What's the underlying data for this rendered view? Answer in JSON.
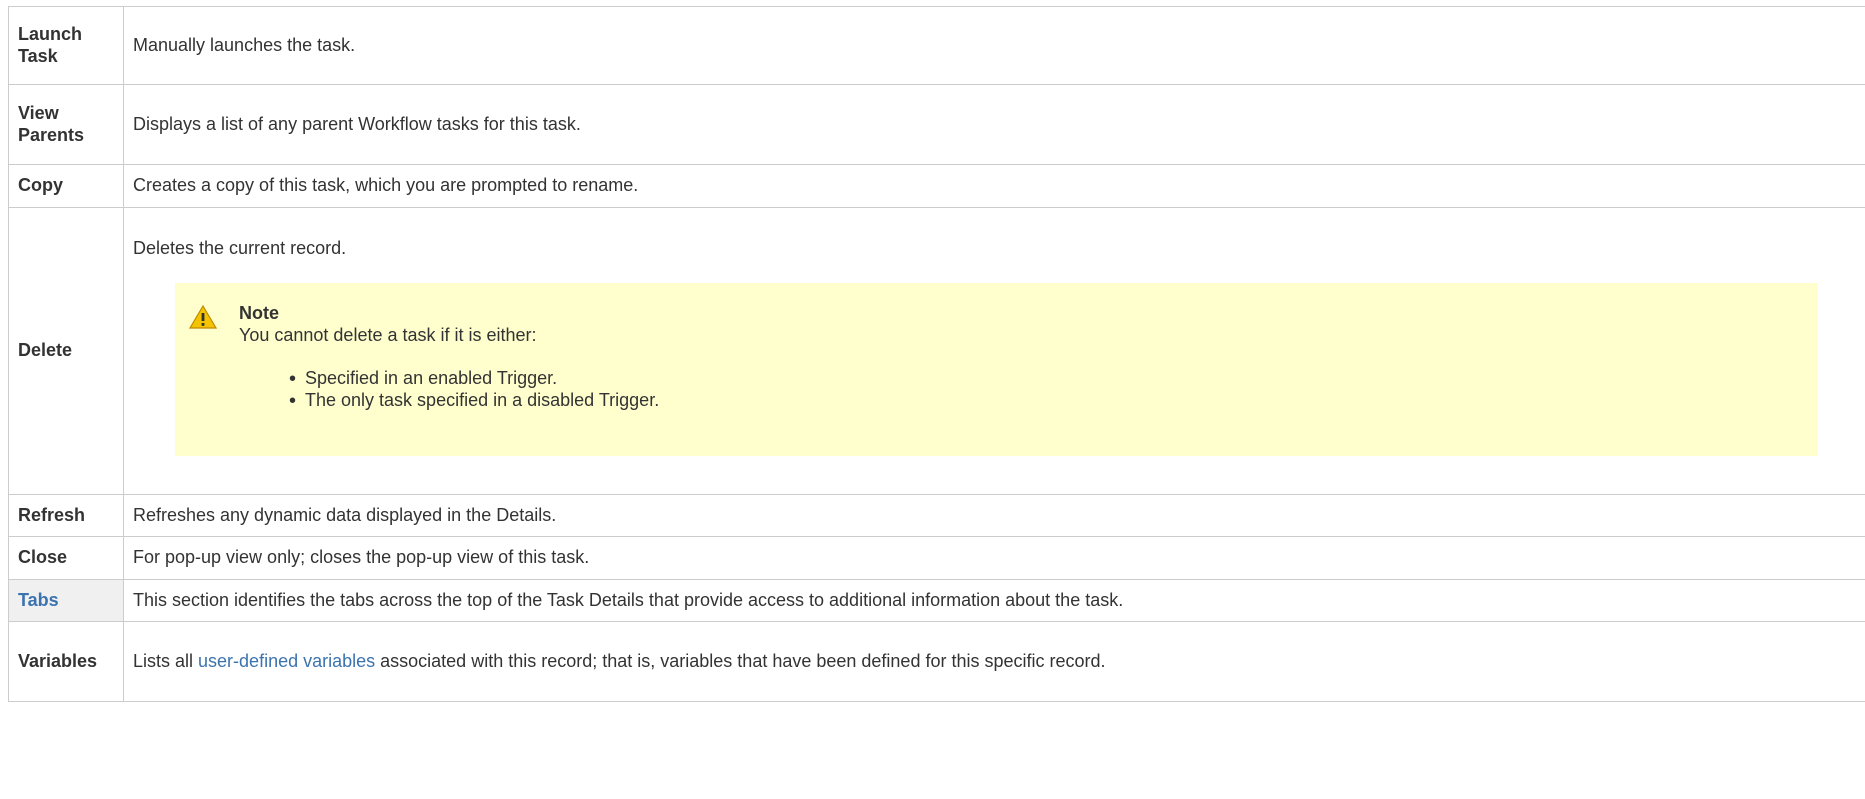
{
  "rows": [
    {
      "label": "Launch Task",
      "label_lines": [
        "Launch",
        "Task"
      ],
      "desc": "Manually launches the task."
    },
    {
      "label": "View Parents",
      "label_lines": [
        "View",
        "Parents"
      ],
      "desc": "Displays a list of any parent Workflow tasks for this task."
    },
    {
      "label": "Copy",
      "desc": "Creates a copy of this task, which you are prompted to rename."
    },
    {
      "label": "Delete",
      "desc": "Deletes the current record."
    },
    {
      "label": "Refresh",
      "desc": "Refreshes any dynamic data displayed in the Details."
    },
    {
      "label": "Close",
      "desc": "For pop-up view only; closes the pop-up view of this task."
    },
    {
      "label": "Tabs",
      "desc": "This section identifies the tabs across the top of the Task Details that provide access to additional information about the task."
    },
    {
      "label": "Variables",
      "desc_prefix": "Lists all ",
      "desc_link": "user-defined variables",
      "desc_suffix": " associated with this record; that is, variables that have been defined for this specific record."
    }
  ],
  "note": {
    "title": "Note",
    "text": "You cannot delete a task if it is either:",
    "items": [
      "Specified in an enabled Trigger.",
      "The only task specified in a disabled Trigger."
    ],
    "icon": "warning-icon",
    "background": "#ffffce"
  },
  "colors": {
    "link": "#3b73af",
    "border": "#cccccc",
    "tabs_bg": "#f0f0f0"
  }
}
